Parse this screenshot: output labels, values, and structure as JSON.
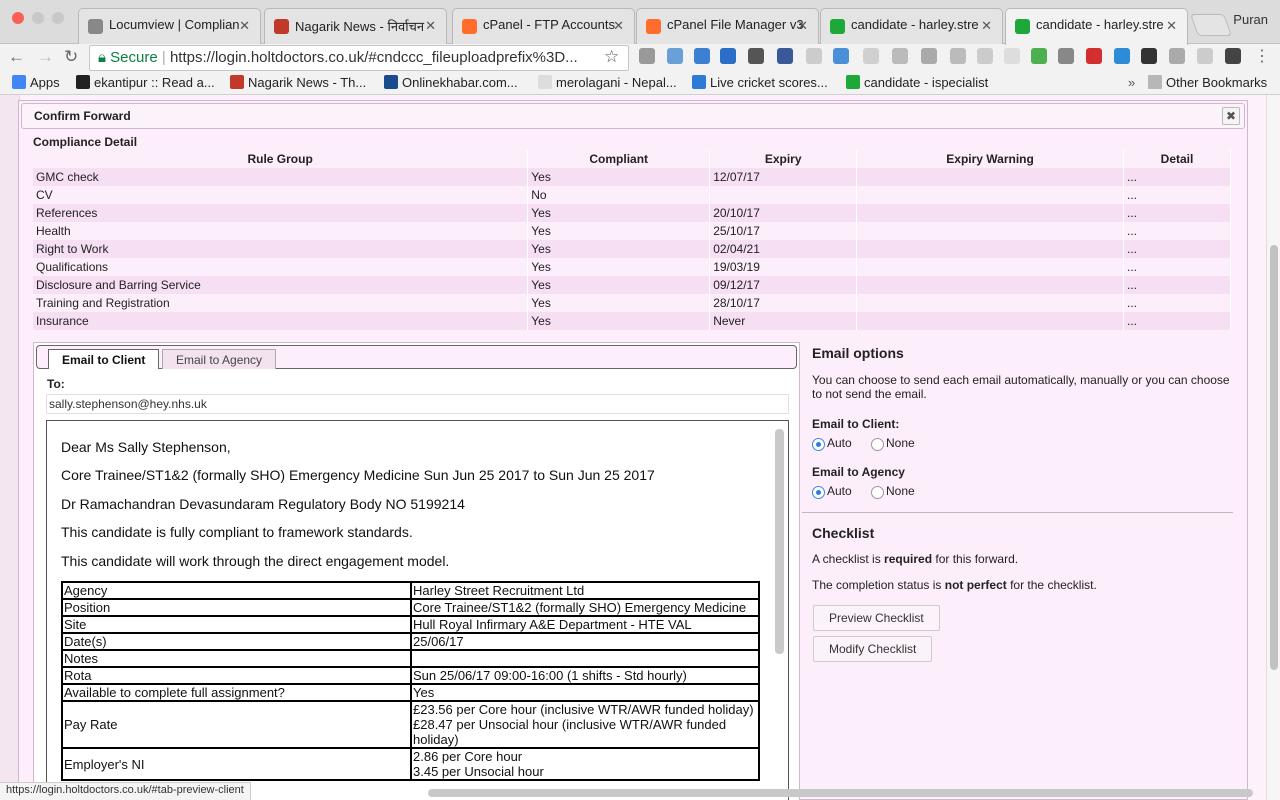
{
  "browser": {
    "tabs": [
      {
        "title": "Locumview | Complian",
        "icon": "document-icon",
        "color": "#888888"
      },
      {
        "title": "Nagarik News - निर्वाचन",
        "icon": "nagarik-icon",
        "color": "#c0392b"
      },
      {
        "title": "cPanel - FTP Accounts",
        "icon": "cpanel-icon",
        "color": "#ff6c2c"
      },
      {
        "title": "cPanel File Manager v3",
        "icon": "cpanel-icon",
        "color": "#ff6c2c"
      },
      {
        "title": "candidate - harley.stre",
        "icon": "green-cross-icon",
        "color": "#1fa83a"
      },
      {
        "title": "candidate - harley.stre",
        "icon": "green-cross-icon",
        "color": "#1fa83a"
      }
    ],
    "user": "Puran",
    "secure_label": "Secure",
    "url": "https://login.holtdoctors.co.uk/#cndccc_fileuploadprefix%3D...",
    "bookmarks": [
      {
        "label": "Apps",
        "icon": "apps-grid-icon",
        "color": "#4285f4"
      },
      {
        "label": "ekantipur :: Read a...",
        "icon": "ekantipur-icon",
        "color": "#222222"
      },
      {
        "label": "Nagarik News - Th...",
        "icon": "nagarik-icon",
        "color": "#c0392b"
      },
      {
        "label": "Onlinekhabar.com...",
        "icon": "onlinekhabar-icon",
        "color": "#1a4b8c"
      },
      {
        "label": "merolagani - Nepal...",
        "icon": "page-icon",
        "color": "#dddddd"
      },
      {
        "label": "Live cricket scores...",
        "icon": "cricket-icon",
        "color": "#2e7bd6"
      },
      {
        "label": "candidate - ispecialist",
        "icon": "green-cross-icon",
        "color": "#1fa83a"
      }
    ],
    "other_bookmarks": "Other Bookmarks",
    "status_url": "https://login.holtdoctors.co.uk/#tab-preview-client"
  },
  "modal": {
    "title": "Confirm Forward",
    "close_glyph": "✖",
    "compliance_title": "Compliance Detail",
    "columns": [
      "Rule Group",
      "Compliant",
      "Expiry",
      "Expiry Warning",
      "Detail"
    ],
    "rows": [
      {
        "rule": "GMC check",
        "compliant": "Yes",
        "expiry": "12/07/17",
        "warning": "",
        "detail": "..."
      },
      {
        "rule": "CV",
        "compliant": "No",
        "expiry": "",
        "warning": "",
        "detail": "..."
      },
      {
        "rule": "References",
        "compliant": "Yes",
        "expiry": "20/10/17",
        "warning": "",
        "detail": "..."
      },
      {
        "rule": "Health",
        "compliant": "Yes",
        "expiry": "25/10/17",
        "warning": "",
        "detail": "..."
      },
      {
        "rule": "Right to Work",
        "compliant": "Yes",
        "expiry": "02/04/21",
        "warning": "",
        "detail": "..."
      },
      {
        "rule": "Qualifications",
        "compliant": "Yes",
        "expiry": "19/03/19",
        "warning": "",
        "detail": "..."
      },
      {
        "rule": "Disclosure and Barring Service",
        "compliant": "Yes",
        "expiry": "09/12/17",
        "warning": "",
        "detail": "..."
      },
      {
        "rule": "Training and Registration",
        "compliant": "Yes",
        "expiry": "28/10/17",
        "warning": "",
        "detail": "..."
      },
      {
        "rule": "Insurance",
        "compliant": "Yes",
        "expiry": "Never",
        "warning": "",
        "detail": "..."
      }
    ]
  },
  "email": {
    "tabs": [
      "Email to Client",
      "Email to Agency"
    ],
    "to_label": "To:",
    "to_value": "sally.stephenson@hey.nhs.uk",
    "paragraphs": [
      "Dear Ms Sally Stephenson,",
      "Core Trainee/ST1&2 (formally SHO) Emergency Medicine Sun Jun 25 2017 to Sun Jun 25 2017",
      "Dr Ramachandran Devasundaram Regulatory Body NO 5199214",
      "This candidate is fully compliant to framework standards.",
      "This candidate will work through the direct engagement model."
    ],
    "details": [
      {
        "k": "Agency",
        "v": "Harley Street Recruitment Ltd"
      },
      {
        "k": "Position",
        "v": "Core Trainee/ST1&2 (formally SHO) Emergency Medicine"
      },
      {
        "k": "Site",
        "v": "Hull Royal Infirmary A&E Department - HTE VAL"
      },
      {
        "k": "Date(s)",
        "v": "25/06/17"
      },
      {
        "k": "Notes",
        "v": ""
      },
      {
        "k": "Rota",
        "v": "Sun 25/06/17 09:00-16:00 (1 shifts - Std hourly)"
      },
      {
        "k": "Available to complete full assignment?",
        "v": "Yes"
      },
      {
        "k": "Pay Rate",
        "v": "£23.56 per Core hour (inclusive WTR/AWR funded holiday)\n£28.47 per Unsocial hour (inclusive WTR/AWR funded holiday)"
      },
      {
        "k": "Employer's NI",
        "v": "2.86 per Core hour\n3.45 per Unsocial hour"
      }
    ]
  },
  "options": {
    "title": "Email options",
    "description": "You can choose to send each email automatically, manually or you can choose to not send the email.",
    "client_label": "Email to Client:",
    "agency_label": "Email to Agency",
    "auto": "Auto",
    "none": "None",
    "client_selected": "Auto",
    "agency_selected": "Auto"
  },
  "checklist": {
    "title": "Checklist",
    "line1_pre": "A checklist is ",
    "line1_bold": "required",
    "line1_post": " for this forward.",
    "line2_pre": "The completion status is ",
    "line2_bold": "not perfect",
    "line2_post": " for the checklist.",
    "preview_button": "Preview Checklist",
    "modify_button": "Modify Checklist"
  }
}
